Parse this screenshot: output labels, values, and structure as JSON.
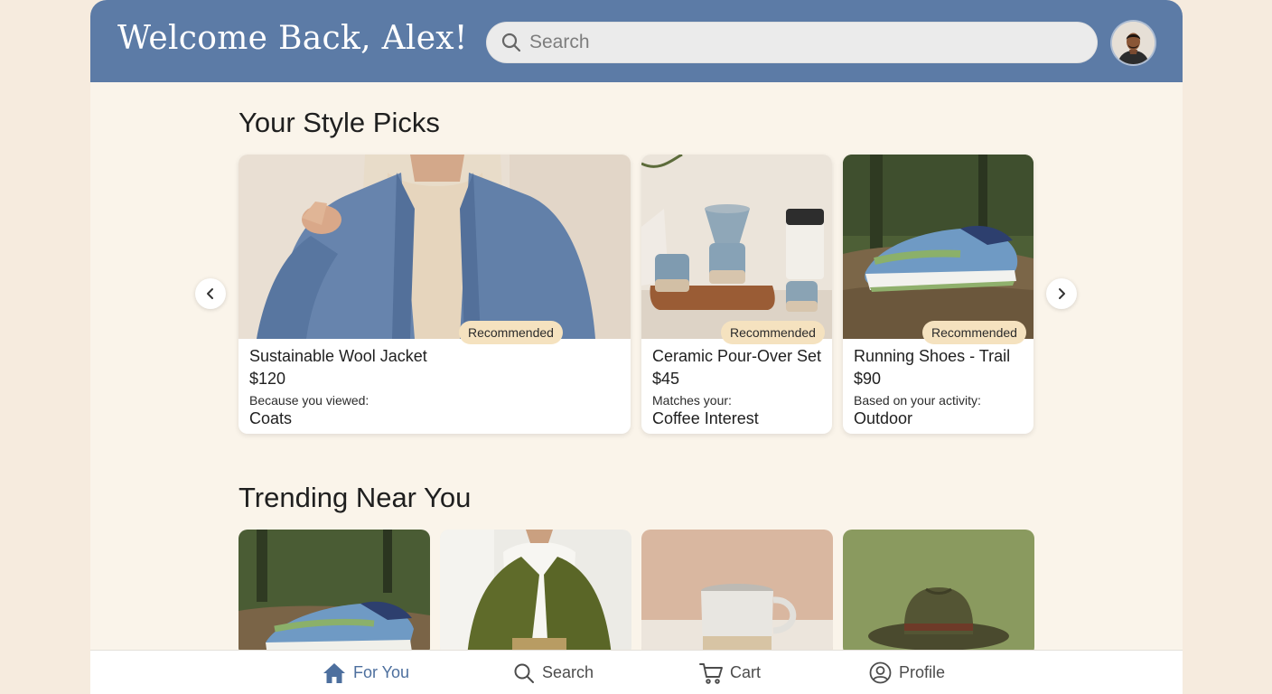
{
  "header": {
    "welcome": "Welcome Back, Alex!",
    "search_placeholder": "Search",
    "bg_color": "#5c7ba6"
  },
  "style_picks": {
    "title": "Your Style Picks",
    "cards": [
      {
        "name": "Sustainable Wool Jacket",
        "price": "$120",
        "reason": "Because you viewed:",
        "reason_value": "Coats",
        "badge": "Recommended",
        "image": "woman-blue-wool-coat"
      },
      {
        "name": "Ceramic Pour-Over Set",
        "price": "$45",
        "reason": "Matches your:",
        "reason_value": "Coffee Interest",
        "badge": "Recommended",
        "image": "ceramic-pour-over-set"
      },
      {
        "name": "Running Shoes - Trail",
        "price": "$90",
        "reason": "Based on your activity:",
        "reason_value": "Outdoor",
        "badge": "Recommended",
        "image": "trail-running-shoes"
      }
    ]
  },
  "trending": {
    "title": "Trending Near You",
    "items": [
      {
        "image": "trail-running-shoes"
      },
      {
        "image": "olive-green-coat"
      },
      {
        "image": "white-ceramic-mug"
      },
      {
        "image": "olive-fedora-hat"
      }
    ]
  },
  "nav": {
    "items": [
      {
        "label": "For You",
        "icon": "home-icon",
        "active": true
      },
      {
        "label": "Search",
        "icon": "search-icon",
        "active": false
      },
      {
        "label": "Cart",
        "icon": "cart-icon",
        "active": false
      },
      {
        "label": "Profile",
        "icon": "profile-icon",
        "active": false
      }
    ],
    "active_color": "#4d6f9e"
  },
  "colors": {
    "badge": "#f5e2bf",
    "page_bg": "#faf4ea"
  }
}
